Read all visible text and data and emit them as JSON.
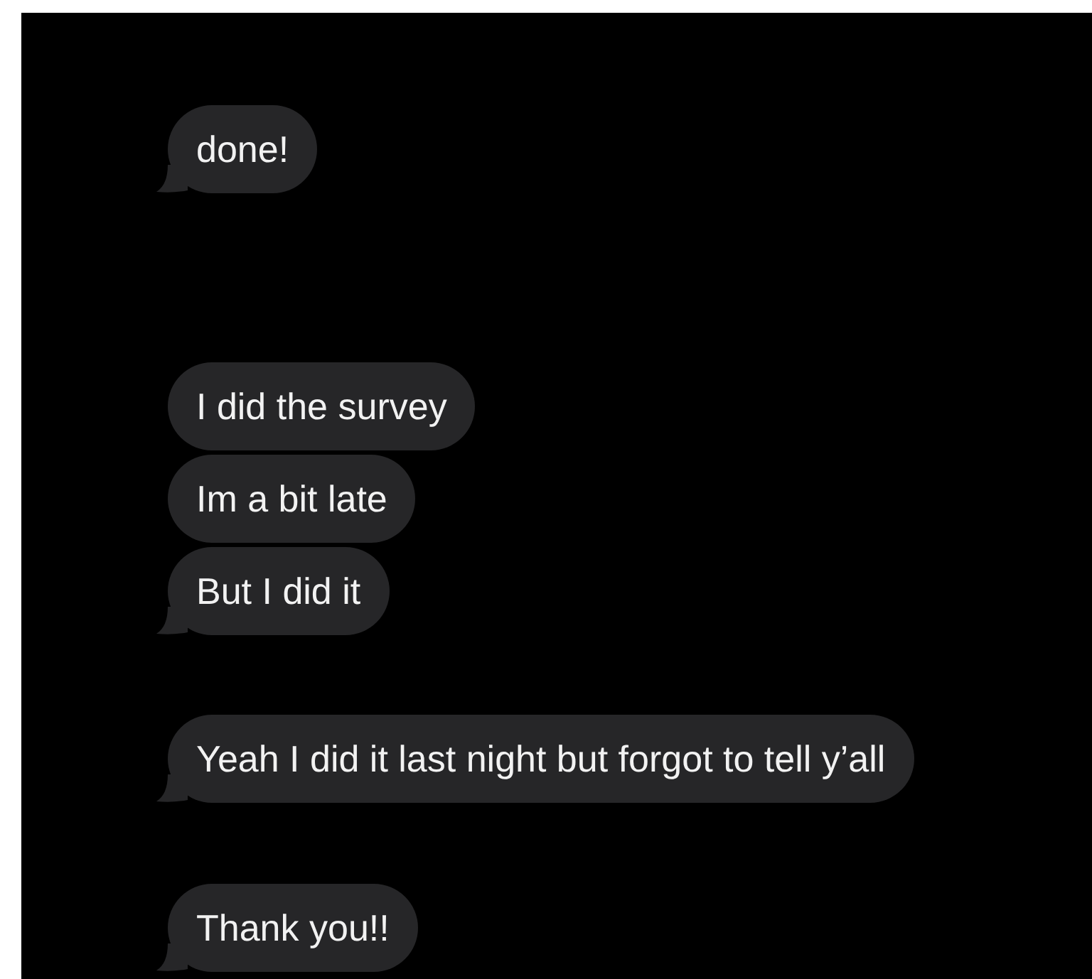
{
  "message_groups": [
    {
      "messages": [
        "done!"
      ]
    },
    {
      "messages": [
        "I did the survey",
        "Im a bit late",
        "But I did it"
      ]
    },
    {
      "messages": [
        "Yeah I did it last night but forgot to tell y’all"
      ]
    },
    {
      "messages": [
        "Thank you!!"
      ]
    }
  ]
}
